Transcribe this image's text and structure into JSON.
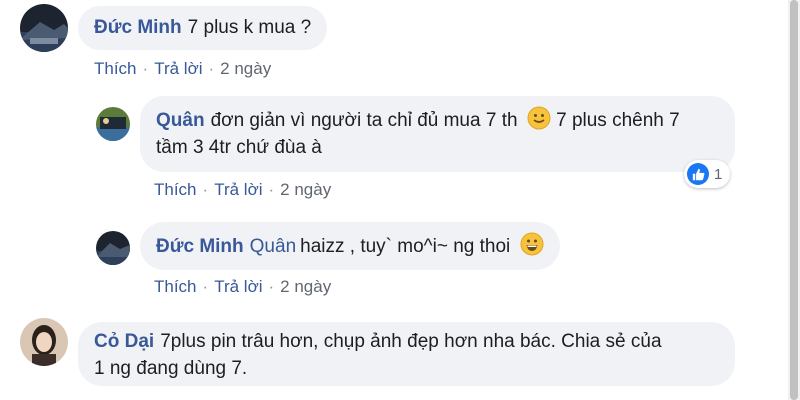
{
  "comments": [
    {
      "author": "Đức Minh",
      "text": "7 plus k mua ?",
      "actions": {
        "like": "Thích",
        "reply": "Trả lời",
        "time": "2 ngày"
      }
    },
    {
      "author": "Quân",
      "text_line1": "đơn giản vì người ta chỉ đủ mua 7 th",
      "text_after_emoji": "7 plus chênh 7",
      "text_line2": "tầm 3 4tr chứ đùa à",
      "emoji": "slightly-smiling-face",
      "reaction": {
        "icon": "like-icon",
        "count": "1"
      },
      "actions": {
        "like": "Thích",
        "reply": "Trả lời",
        "time": "2 ngày"
      }
    },
    {
      "author": "Đức Minh",
      "mention": "Quân",
      "text": "haizz , tuy` mo^i~ ng thoi",
      "emoji": "grinning-face",
      "actions": {
        "like": "Thích",
        "reply": "Trả lời",
        "time": "2 ngày"
      }
    },
    {
      "author": "Cỏ Dại",
      "text_line1": "7plus pin trâu hơn, chụp ảnh đẹp hơn nha bác. Chia sẻ của",
      "text_line2": "1 ng đang dùng 7."
    }
  ],
  "colors": {
    "link": "#385898",
    "bubble": "#f0f2f5",
    "meta": "#606770",
    "like_blue": "#1877f2"
  }
}
